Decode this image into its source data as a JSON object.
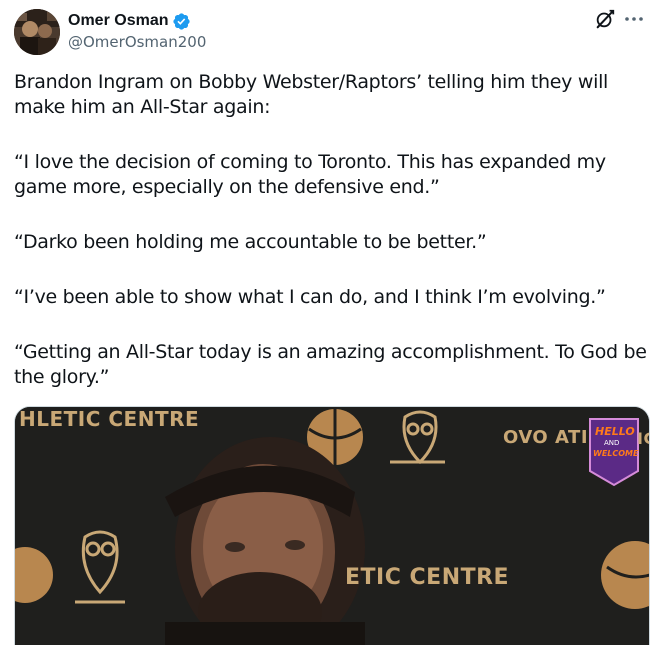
{
  "author": {
    "display_name": "Omer Osman",
    "handle": "@OmerOsman200",
    "verified": true
  },
  "icons": {
    "avatar": "avatar-photo",
    "verified": "verified-badge-icon",
    "grok": "grok-icon",
    "more": "more-options-icon"
  },
  "colors": {
    "verified_blue": "#1d9bf0",
    "text": "#0f1419",
    "secondary": "#536471",
    "wall_gold": "#c9a876"
  },
  "tweet": {
    "paragraphs": [
      "Brandon Ingram on Bobby Webster/Raptors’ telling him they will make him an All-Star again:",
      "“I love the decision of coming to Toronto. This has expanded my game more, especially on the defensive end.”",
      "“Darko been holding me accountable to be better.”",
      "“I’ve been able to show what I can do, and I think I’m evolving.”",
      "“Getting an All-Star today is an amazing accomplishment. To God be the glory.”"
    ]
  },
  "media": {
    "wall_text_top_left": "HLETIC CENTRE",
    "wall_text_top_right": "OVO ATI",
    "wall_text_edge": "IC",
    "wall_text_bottom": "ETIC CENTRE",
    "sign_line1": "HELLO",
    "sign_line2": "AND",
    "sign_line3": "WELCOME"
  }
}
